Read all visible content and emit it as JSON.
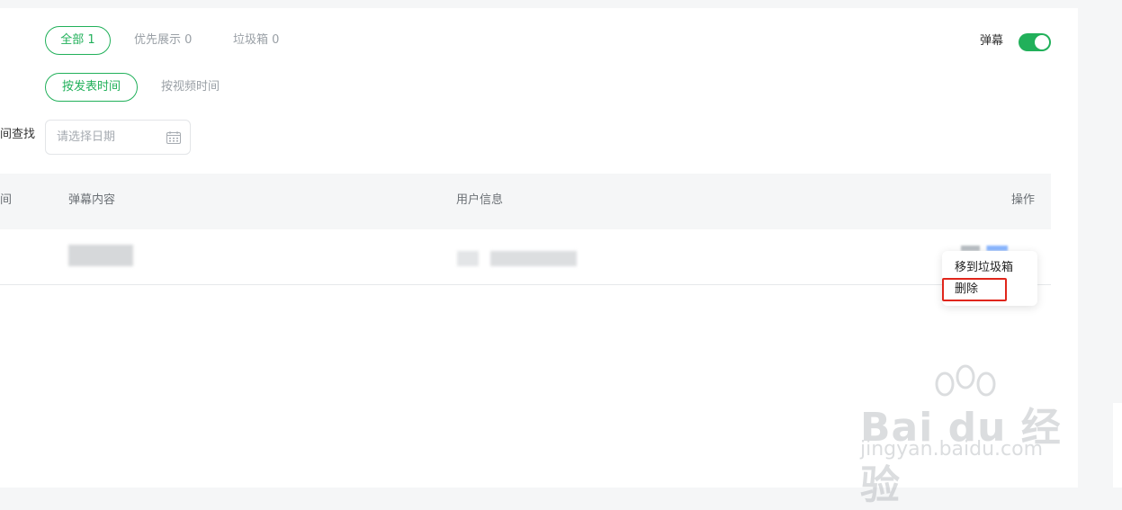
{
  "filters": {
    "status_tabs": [
      {
        "label": "全部 1",
        "active": true
      },
      {
        "label": "优先展示 0",
        "active": false
      },
      {
        "label": "垃圾箱 0",
        "active": false
      }
    ],
    "sort_tabs": [
      {
        "label": "按发表时间",
        "active": true
      },
      {
        "label": "按视频时间",
        "active": false
      }
    ],
    "danmaku_toggle": {
      "label": "弹幕",
      "on": true
    },
    "date_search": {
      "label": "间查找",
      "placeholder": "请选择日期"
    }
  },
  "table": {
    "headers": {
      "time": "间",
      "content": "弹幕内容",
      "user": "用户信息",
      "actions": "操作"
    }
  },
  "row_menu": {
    "items": [
      "移到垃圾箱",
      "删除"
    ],
    "highlighted": "删除"
  },
  "watermark": {
    "brand": "Bai du 经验",
    "url": "jingyan.baidu.com"
  },
  "colors": {
    "accent": "#21b05a",
    "highlight": "#e0261b"
  }
}
